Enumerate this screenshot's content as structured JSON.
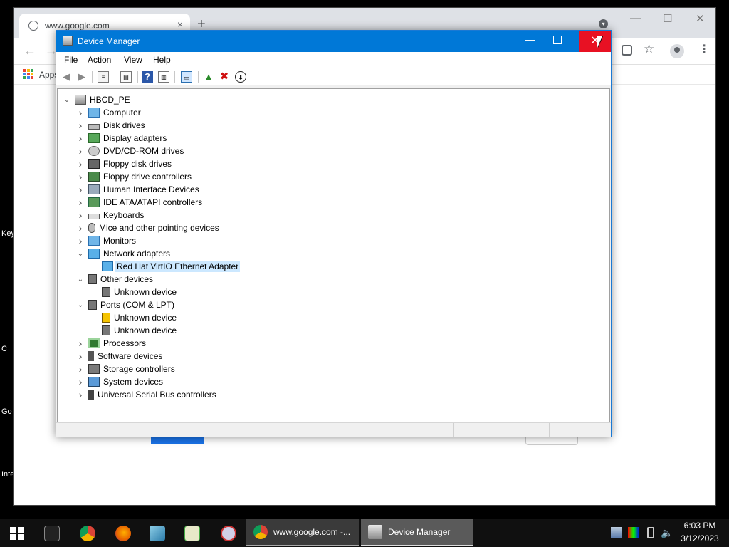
{
  "desktop": {
    "edge_labels": [
      "Key",
      "C",
      "Go",
      "Inte"
    ]
  },
  "chrome": {
    "tab_title": "www.google.com",
    "tab_close": "×",
    "new_tab": "+",
    "bookmarks_apps": "Apps"
  },
  "device_manager": {
    "title": "Device Manager",
    "controls": {
      "minimize": "—",
      "close": "✕"
    },
    "menu": [
      "File",
      "Action",
      "View",
      "Help"
    ],
    "tree": [
      {
        "label": "HBCD_PE",
        "level": 0,
        "expand": "open",
        "icon": "computer-root-icon"
      },
      {
        "label": "Computer",
        "level": 1,
        "expand": "closed",
        "icon": "monitor-icon"
      },
      {
        "label": "Disk drives",
        "level": 1,
        "expand": "closed",
        "icon": "disk-drive-icon"
      },
      {
        "label": "Display adapters",
        "level": 1,
        "expand": "closed",
        "icon": "display-adapter-icon"
      },
      {
        "label": "DVD/CD-ROM drives",
        "level": 1,
        "expand": "closed",
        "icon": "dvd-drive-icon"
      },
      {
        "label": "Floppy disk drives",
        "level": 1,
        "expand": "closed",
        "icon": "floppy-disk-icon"
      },
      {
        "label": "Floppy drive controllers",
        "level": 1,
        "expand": "closed",
        "icon": "floppy-controller-icon"
      },
      {
        "label": "Human Interface Devices",
        "level": 1,
        "expand": "closed",
        "icon": "hid-icon"
      },
      {
        "label": "IDE ATA/ATAPI controllers",
        "level": 1,
        "expand": "closed",
        "icon": "ide-controller-icon"
      },
      {
        "label": "Keyboards",
        "level": 1,
        "expand": "closed",
        "icon": "keyboard-icon"
      },
      {
        "label": "Mice and other pointing devices",
        "level": 1,
        "expand": "closed",
        "icon": "mouse-icon"
      },
      {
        "label": "Monitors",
        "level": 1,
        "expand": "closed",
        "icon": "monitor-icon"
      },
      {
        "label": "Network adapters",
        "level": 1,
        "expand": "open",
        "icon": "network-adapter-icon"
      },
      {
        "label": "Red Hat VirtIO Ethernet Adapter",
        "level": 2,
        "expand": "none",
        "icon": "network-adapter-icon",
        "selected": true
      },
      {
        "label": "Other devices",
        "level": 1,
        "expand": "open",
        "icon": "unknown-device-icon"
      },
      {
        "label": "Unknown device",
        "level": 2,
        "expand": "none",
        "icon": "unknown-device-icon"
      },
      {
        "label": "Ports (COM & LPT)",
        "level": 1,
        "expand": "open",
        "icon": "port-icon"
      },
      {
        "label": "Unknown device",
        "level": 2,
        "expand": "none",
        "icon": "warning-device-icon"
      },
      {
        "label": "Unknown device",
        "level": 2,
        "expand": "none",
        "icon": "port-icon"
      },
      {
        "label": "Processors",
        "level": 1,
        "expand": "closed",
        "icon": "processor-icon"
      },
      {
        "label": "Software devices",
        "level": 1,
        "expand": "closed",
        "icon": "software-device-icon"
      },
      {
        "label": "Storage controllers",
        "level": 1,
        "expand": "closed",
        "icon": "storage-controller-icon"
      },
      {
        "label": "System devices",
        "level": 1,
        "expand": "closed",
        "icon": "system-device-icon"
      },
      {
        "label": "Universal Serial Bus controllers",
        "level": 1,
        "expand": "closed",
        "icon": "usb-icon"
      }
    ]
  },
  "taskbar": {
    "tasks": [
      "www.google.com -...",
      "Device Manager"
    ],
    "clock_time": "6:03 PM",
    "clock_date": "3/12/2023"
  },
  "colors": {
    "titlebar": "#0078d7",
    "close_hover": "#e81123",
    "selection": "#cce8ff"
  }
}
